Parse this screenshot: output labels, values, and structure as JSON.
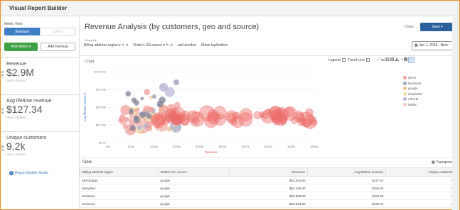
{
  "app": {
    "title": "Visual Report Builder"
  },
  "sidebar": {
    "metric_view_label": "Metric View",
    "standard": "Standard",
    "cohort": "Cohort",
    "add_metric": "Add Metric",
    "add_formula": "Add Formula",
    "metrics": [
      {
        "name": "Revenue",
        "value": "$2.9M",
        "links": "Hide  |  Details"
      },
      {
        "name": "Avg lifetime revenue",
        "value": "$127.34",
        "links": "Hide  |  Details"
      },
      {
        "name": "Unique customers",
        "value": "9.2k",
        "links": "Hide  |  Details"
      }
    ],
    "guide": "Report Builder Guide"
  },
  "header": {
    "title": "Revenue Analysis (by customers, geo and source)",
    "close": "Close",
    "save": "Save",
    "group_by": "Group By",
    "chips": [
      "Billing address region ▾ ✎ ✕",
      "Order's GA source ▾ ✎ ✕",
      "add another",
      "Show top/bottom"
    ],
    "date_range": "Jan 1, 2019 - Now"
  },
  "chart_toolbar": {
    "chart_label": "Chart",
    "legend": "Legend",
    "trend": "Trend Line"
  },
  "chart_data": {
    "type": "scatter",
    "xlabel": "Revenue",
    "ylabel": "Avg lifetime revenue",
    "xticks": [
      "10k",
      "$70k",
      "$130k",
      "$190k",
      "$250k",
      "$310k",
      "$370k",
      "$430k",
      "$490k",
      "$550k"
    ],
    "yticks": [
      "$0.00",
      "$25.00k",
      "$50.00k",
      "$75.00k",
      "$100.00k"
    ],
    "ylim": [
      0,
      100000
    ],
    "legend": [
      {
        "name": "direct",
        "color": "#f2a09c"
      },
      {
        "name": "facebook",
        "color": "#9aa0b7"
      },
      {
        "name": "google",
        "color": "#f3c08f"
      },
      {
        "name": "newsletter",
        "color": "#f2dfa0"
      },
      {
        "name": "referral",
        "color": "#b7b3d8"
      },
      {
        "name": "twitter",
        "color": "#f4c6c3"
      }
    ]
  },
  "table": {
    "label": "Table",
    "transpose": "Transpose",
    "columns": [
      "Billing address region",
      "Order's GA source",
      "Revenue",
      "Avg lifetime revenue",
      "Unique customers"
    ],
    "rows": [
      [
        "Mississippi",
        "google",
        "$53,300.50",
        "$217.01",
        "30"
      ],
      [
        "Maryland",
        "google",
        "$52,195.30",
        "$184.02",
        "30"
      ],
      [
        "Montana",
        "google",
        "$49,358.50",
        "$184.82",
        "30"
      ],
      [
        "Kentucky",
        "google",
        "$48,944.50",
        "$240.47",
        "20"
      ]
    ]
  }
}
